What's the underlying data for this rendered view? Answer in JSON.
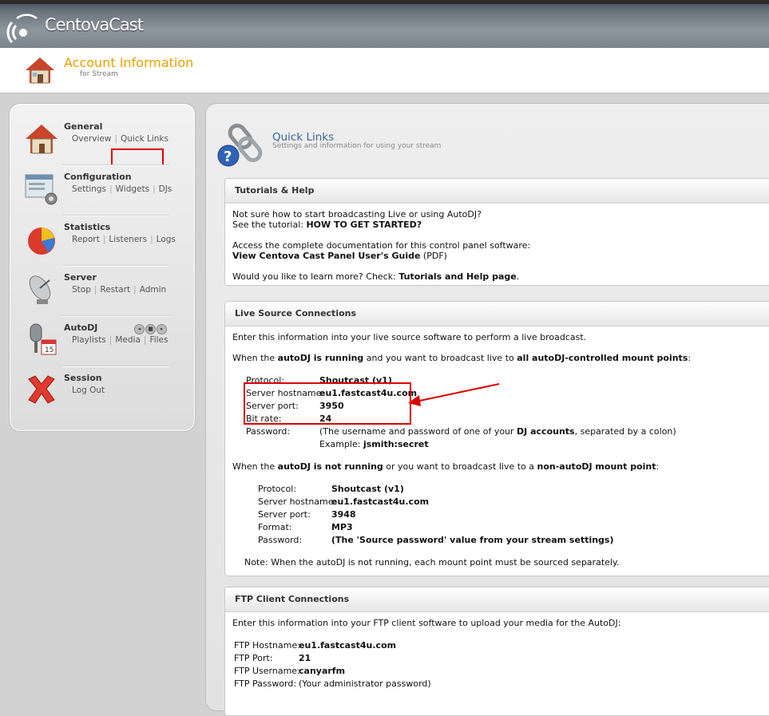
{
  "app": {
    "brand": "CentovaCast"
  },
  "header": {
    "title": "Account Information",
    "subtitle": "for Stream"
  },
  "sidebar": {
    "groups": [
      {
        "title": "General",
        "links": [
          "Overview",
          "Quick Links"
        ]
      },
      {
        "title": "Configuration",
        "links": [
          "Settings",
          "Widgets",
          "DJs"
        ]
      },
      {
        "title": "Statistics",
        "links": [
          "Report",
          "Listeners",
          "Logs"
        ]
      },
      {
        "title": "Server",
        "links": [
          "Stop",
          "Restart",
          "Admin"
        ]
      },
      {
        "title": "AutoDJ",
        "links": [
          "Playlists",
          "Media",
          "Files"
        ]
      },
      {
        "title": "Session",
        "links": [
          "Log Out"
        ]
      }
    ]
  },
  "main": {
    "title": "Quick Links",
    "subtitle": "Settings and information for using your stream"
  },
  "tutorials": {
    "heading": "Tutorials & Help",
    "line1": "Not sure how to start broadcasting Live or using AutoDJ?",
    "line2_prefix": "See the tutorial: ",
    "line2_link": "HOW TO GET STARTED?",
    "line3": "Access the complete documentation for this control panel software:",
    "line4_link": "View Centova Cast Panel User's Guide",
    "line4_suffix": " (PDF)",
    "line5_prefix": "Would you like to learn more? Check: ",
    "line5_link": "Tutorials and Help page",
    "line5_suffix": "."
  },
  "live": {
    "heading": "Live Source Connections",
    "intro": "Enter this information into your live source software to perform a live broadcast.",
    "p1_a": "When the ",
    "p1_b": "autoDJ is running",
    "p1_c": " and you want to broadcast live to ",
    "p1_d": "all autoDJ-controlled mount points",
    "p1_e": ":",
    "running": [
      {
        "label": "Protocol:",
        "value": "Shoutcast (v1)"
      },
      {
        "label": "Server hostname:",
        "value": "eu1.fastcast4u.com"
      },
      {
        "label": "Server port:",
        "value": "3950"
      },
      {
        "label": "Bit rate:",
        "value": "24"
      }
    ],
    "password_label": "Password:",
    "password_a": "(The username and password of one of your ",
    "password_b": "DJ accounts",
    "password_c": ", separated by a colon)",
    "example_label": "Example: ",
    "example_value": "jsmith:secret",
    "p2_a": "When the ",
    "p2_b": "autoDJ is not running",
    "p2_c": " or you want to broadcast live to a ",
    "p2_d": "non-autoDJ mount point",
    "p2_e": ":",
    "not_running": [
      {
        "label": "Protocol:",
        "value": "Shoutcast (v1)"
      },
      {
        "label": "Server hostname:",
        "value": "eu1.fastcast4u.com"
      },
      {
        "label": "Server port:",
        "value": "3948"
      },
      {
        "label": "Format:",
        "value": "MP3"
      },
      {
        "label": "Password:",
        "value": "(The 'Source password' value from your stream settings)"
      }
    ],
    "note": "Note: When the autoDJ is not running, each mount point must be sourced separately."
  },
  "ftp": {
    "heading": "FTP Client Connections",
    "intro": "Enter this information into your FTP client software to upload your media for the AutoDJ:",
    "rows": [
      {
        "label": "FTP Hostname:",
        "value": "eu1.fastcast4u.com"
      },
      {
        "label": "FTP Port:",
        "value": "21"
      },
      {
        "label": "FTP Username:",
        "value": "canyarfm"
      },
      {
        "label": "FTP Password:",
        "value": "(Your administrator password)"
      }
    ]
  },
  "colors": {
    "accent_orange": "#e8a000",
    "link_blue": "#38659a",
    "highlight_red": "#dd0000"
  }
}
